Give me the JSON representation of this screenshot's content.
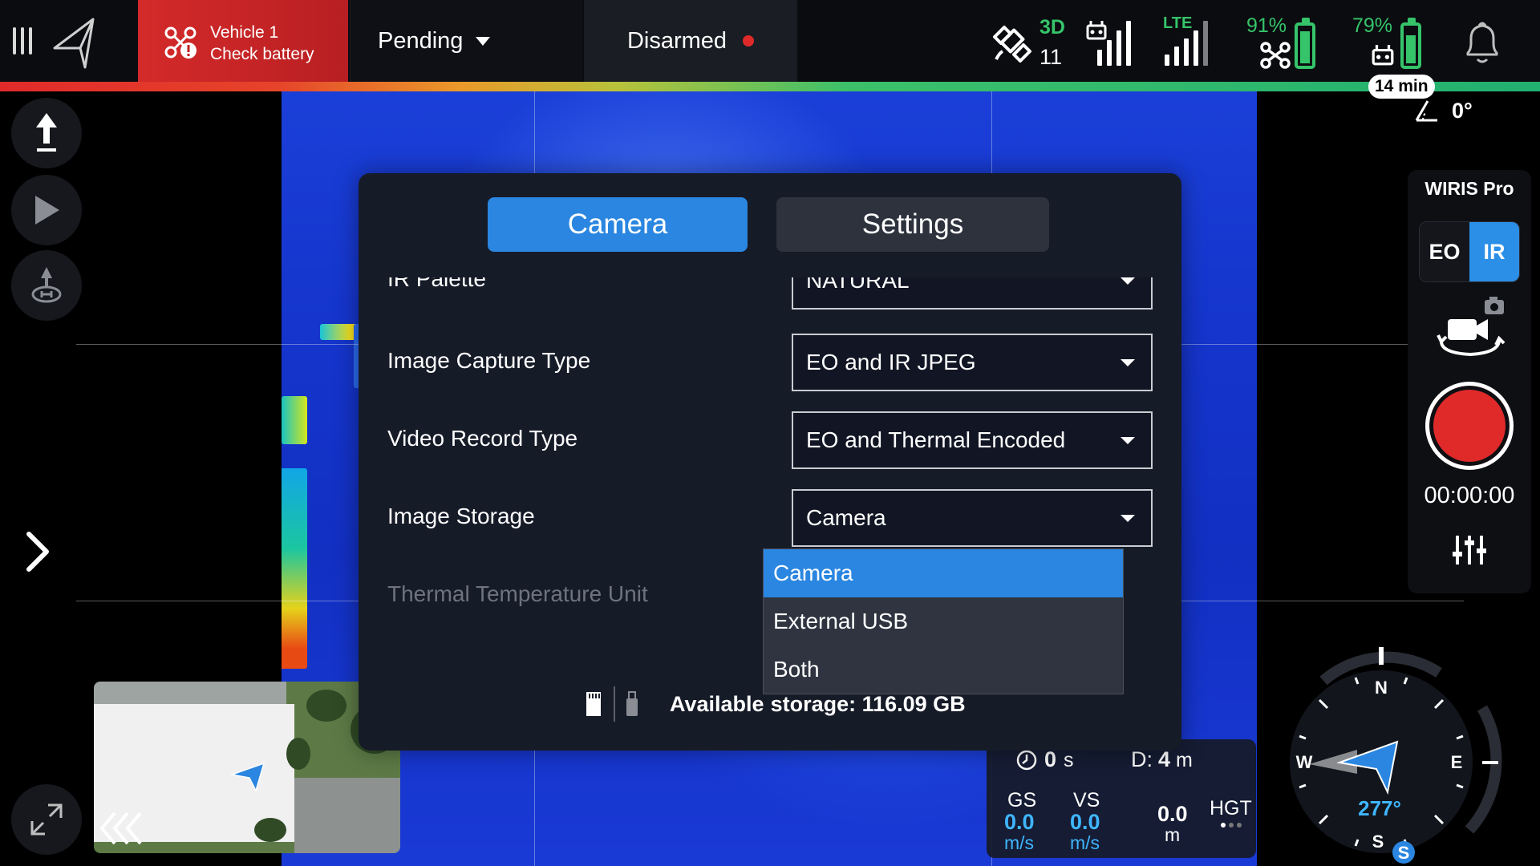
{
  "topbar": {
    "vehicle_name": "Vehicle 1",
    "vehicle_alert": "Check battery",
    "flight_mode": "Pending",
    "arm_state": "Disarmed",
    "gps_fix": "3D",
    "satellites": "11",
    "network": "LTE",
    "drone_battery_pct": "91%",
    "drone_battery_level": 0.91,
    "controller_battery_pct": "79%",
    "controller_battery_level": 0.79,
    "remaining_time": "14 min"
  },
  "gimbal_tilt": "0°",
  "camera_panel": {
    "title": "WIRIS Pro",
    "mode_eo": "EO",
    "mode_ir": "IR",
    "active_mode": "IR",
    "record_time": "00:00:00"
  },
  "modal": {
    "tabs": [
      {
        "label": "Camera",
        "active": true
      },
      {
        "label": "Settings",
        "active": false
      }
    ],
    "rows": [
      {
        "label": "IR Palette",
        "value": "NATURAL"
      },
      {
        "label": "Image Capture Type",
        "value": "EO and IR JPEG"
      },
      {
        "label": "Video Record Type",
        "value": "EO and Thermal Encoded"
      },
      {
        "label": "Image Storage",
        "value": "Camera"
      },
      {
        "label": "Thermal Temperature Unit",
        "value": ""
      }
    ],
    "dropdown_options": [
      "Camera",
      "External USB",
      "Both"
    ],
    "dropdown_selected": "Camera",
    "storage_text_prefix": "Available ",
    "storage_text_overlapped": "storage: 116.09 GB"
  },
  "telemetry": {
    "time_value": "0",
    "time_unit": "s",
    "distance_label": "D:",
    "distance_value": "4",
    "distance_unit": "m",
    "gs_label": "GS",
    "gs_value": "0.0",
    "gs_unit": "m/s",
    "vs_label": "VS",
    "vs_value": "0.0",
    "vs_unit": "m/s",
    "alt_value": "0.0",
    "alt_unit": "m",
    "hgt_label": "HGT"
  },
  "compass": {
    "heading": "277°",
    "n": "N",
    "e": "E",
    "s": "S",
    "w": "W",
    "badge": "S"
  },
  "colors": {
    "accent": "#2a86e0",
    "alert": "#d42a2a",
    "battery": "#35c46a",
    "telemetry_value": "#3fb6ff"
  }
}
